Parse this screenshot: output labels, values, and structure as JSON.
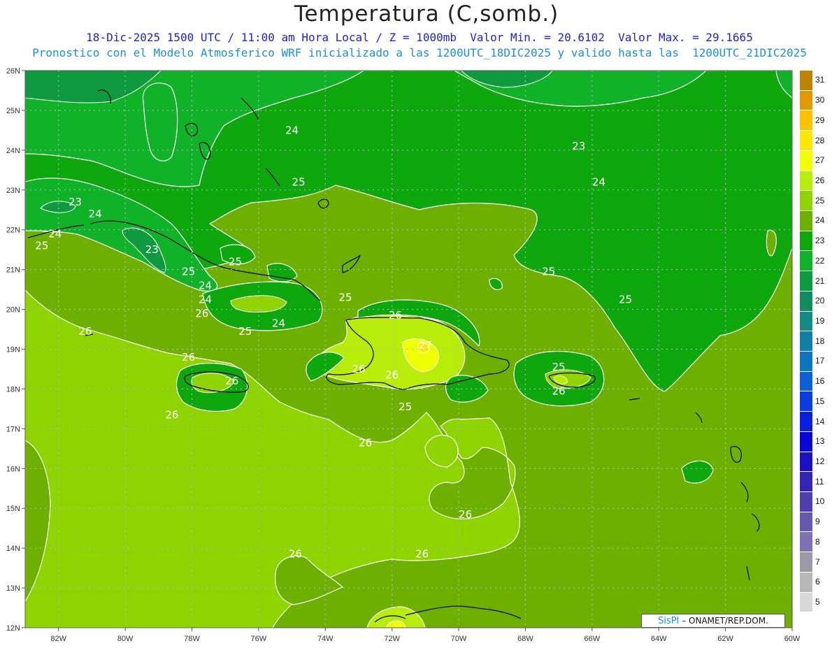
{
  "title": "Temperatura (C,somb.)",
  "subtitle_line1": "18-Dic-2025 1500 UTC / 11:00 am Hora Local / Z = 1000mb  Valor Min. = 20.6102  Valor Max. = 29.1665",
  "subtitle_line2": "Pronostico con el Modelo Atmosferico WRF inicializado a las 1200UTC_18DIC2025 y valido hasta las  1200UTC_21DIC2025",
  "credit": {
    "brand": "SisPI",
    "text": " – ONAMET/REP.DOM."
  },
  "map": {
    "lon_range": [
      -83,
      -60
    ],
    "lat_range": [
      12,
      26
    ],
    "lon_ticks": [
      "82W",
      "80W",
      "78W",
      "76W",
      "74W",
      "72W",
      "70W",
      "68W",
      "66W",
      "64W",
      "62W",
      "60W"
    ],
    "lat_ticks": [
      "26N",
      "25N",
      "24N",
      "23N",
      "22N",
      "21N",
      "20N",
      "19N",
      "18N",
      "17N",
      "16N",
      "15N",
      "14N",
      "13N",
      "12N"
    ],
    "grid": "dotted",
    "contour_labels": [
      {
        "text": "24",
        "lon": -75.0,
        "lat": 24.5
      },
      {
        "text": "23",
        "lon": -66.4,
        "lat": 24.1
      },
      {
        "text": "24",
        "lon": -65.8,
        "lat": 23.2
      },
      {
        "text": "25",
        "lon": -74.8,
        "lat": 23.2
      },
      {
        "text": "23",
        "lon": -81.5,
        "lat": 22.7
      },
      {
        "text": "24",
        "lon": -80.9,
        "lat": 22.4
      },
      {
        "text": "24",
        "lon": -82.1,
        "lat": 21.9
      },
      {
        "text": "25",
        "lon": -82.5,
        "lat": 21.6
      },
      {
        "text": "23",
        "lon": -79.2,
        "lat": 21.5
      },
      {
        "text": "25",
        "lon": -76.7,
        "lat": 21.2
      },
      {
        "text": "25",
        "lon": -78.1,
        "lat": 20.95
      },
      {
        "text": "25",
        "lon": -67.3,
        "lat": 20.95
      },
      {
        "text": "24",
        "lon": -77.6,
        "lat": 20.6
      },
      {
        "text": "24",
        "lon": -77.6,
        "lat": 20.25
      },
      {
        "text": "25",
        "lon": -73.4,
        "lat": 20.3
      },
      {
        "text": "25",
        "lon": -65.0,
        "lat": 20.25
      },
      {
        "text": "26",
        "lon": -77.7,
        "lat": 19.9
      },
      {
        "text": "26",
        "lon": -71.9,
        "lat": 19.85
      },
      {
        "text": "24",
        "lon": -75.4,
        "lat": 19.65
      },
      {
        "text": "25",
        "lon": -76.4,
        "lat": 19.45
      },
      {
        "text": "26",
        "lon": -81.2,
        "lat": 19.45
      },
      {
        "text": "27",
        "lon": -71.0,
        "lat": 19.1
      },
      {
        "text": "26",
        "lon": -78.1,
        "lat": 18.8
      },
      {
        "text": "26",
        "lon": -73.0,
        "lat": 18.5
      },
      {
        "text": "25",
        "lon": -67.0,
        "lat": 18.55
      },
      {
        "text": "26",
        "lon": -72.0,
        "lat": 18.35
      },
      {
        "text": "26",
        "lon": -76.8,
        "lat": 18.2
      },
      {
        "text": "26",
        "lon": -67.0,
        "lat": 17.95
      },
      {
        "text": "25",
        "lon": -71.6,
        "lat": 17.55
      },
      {
        "text": "26",
        "lon": -78.6,
        "lat": 17.35
      },
      {
        "text": "26",
        "lon": -72.8,
        "lat": 16.65
      },
      {
        "text": "26",
        "lon": -69.8,
        "lat": 14.85
      },
      {
        "text": "26",
        "lon": -74.9,
        "lat": 13.85
      },
      {
        "text": "26",
        "lon": -71.1,
        "lat": 13.85
      }
    ]
  },
  "colorbar": {
    "levels": [
      {
        "label": "31",
        "color": "#c08000"
      },
      {
        "label": "30",
        "color": "#e09a00"
      },
      {
        "label": "29",
        "color": "#ffc000"
      },
      {
        "label": "28",
        "color": "#ffe800"
      },
      {
        "label": "27",
        "color": "#f0ff00"
      },
      {
        "label": "26",
        "color": "#b8ec0a"
      },
      {
        "label": "25",
        "color": "#8fd400"
      },
      {
        "label": "24",
        "color": "#6db000"
      },
      {
        "label": "23",
        "color": "#0ea80e"
      },
      {
        "label": "22",
        "color": "#10b228"
      },
      {
        "label": "21",
        "color": "#109a40"
      },
      {
        "label": "20",
        "color": "#148c62"
      },
      {
        "label": "19",
        "color": "#128c84"
      },
      {
        "label": "18",
        "color": "#1080a8"
      },
      {
        "label": "17",
        "color": "#0e74c4"
      },
      {
        "label": "16",
        "color": "#0c60d8"
      },
      {
        "label": "15",
        "color": "#0a3ee0"
      },
      {
        "label": "14",
        "color": "#0a1ee0"
      },
      {
        "label": "13",
        "color": "#0a06d8"
      },
      {
        "label": "12",
        "color": "#1a10c4"
      },
      {
        "label": "11",
        "color": "#3426b4"
      },
      {
        "label": "10",
        "color": "#4e40ae"
      },
      {
        "label": "9",
        "color": "#6858b2"
      },
      {
        "label": "8",
        "color": "#8070b6"
      },
      {
        "label": "7",
        "color": "#9c98a8"
      },
      {
        "label": "6",
        "color": "#b8b8b8"
      },
      {
        "label": "5",
        "color": "#d8d8d8"
      },
      {
        "label": "",
        "color": "#ffffff"
      }
    ]
  }
}
